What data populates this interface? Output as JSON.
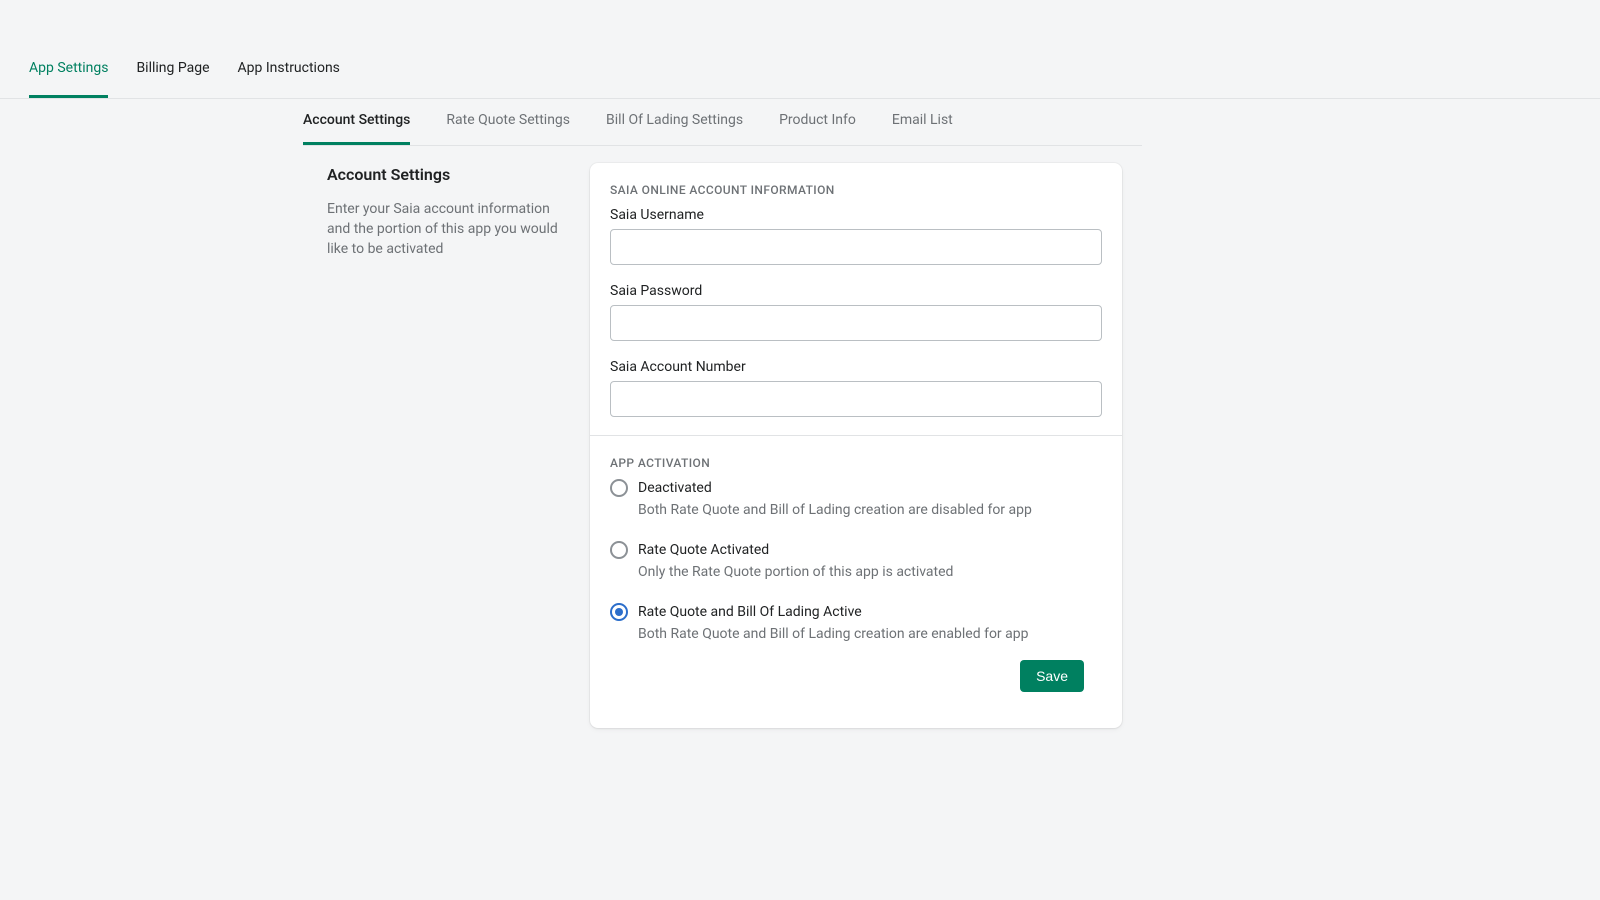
{
  "topnav": {
    "tabs": [
      {
        "label": "App Settings",
        "active": true
      },
      {
        "label": "Billing Page",
        "active": false
      },
      {
        "label": "App Instructions",
        "active": false
      }
    ]
  },
  "subnav": {
    "tabs": [
      {
        "label": "Account Settings",
        "active": true
      },
      {
        "label": "Rate Quote Settings",
        "active": false
      },
      {
        "label": "Bill Of Lading Settings",
        "active": false
      },
      {
        "label": "Product Info",
        "active": false
      },
      {
        "label": "Email List",
        "active": false
      }
    ]
  },
  "side": {
    "title": "Account Settings",
    "desc": "Enter your Saia account information and the portion of this app you would like to be activated"
  },
  "form": {
    "section1_title": "SAIA ONLINE ACCOUNT INFORMATION",
    "fields": {
      "username": {
        "label": "Saia Username",
        "value": ""
      },
      "password": {
        "label": "Saia Password",
        "value": ""
      },
      "account": {
        "label": "Saia Account Number",
        "value": ""
      }
    },
    "section2_title": "APP ACTIVATION",
    "radios": [
      {
        "label": "Deactivated",
        "help": "Both Rate Quote and Bill of Lading creation are disabled for app",
        "checked": false
      },
      {
        "label": "Rate Quote Activated",
        "help": "Only the Rate Quote portion of this app is activated",
        "checked": false
      },
      {
        "label": "Rate Quote and Bill Of Lading Active",
        "help": "Both Rate Quote and Bill of Lading creation are enabled for app",
        "checked": true
      }
    ],
    "save_label": "Save"
  }
}
